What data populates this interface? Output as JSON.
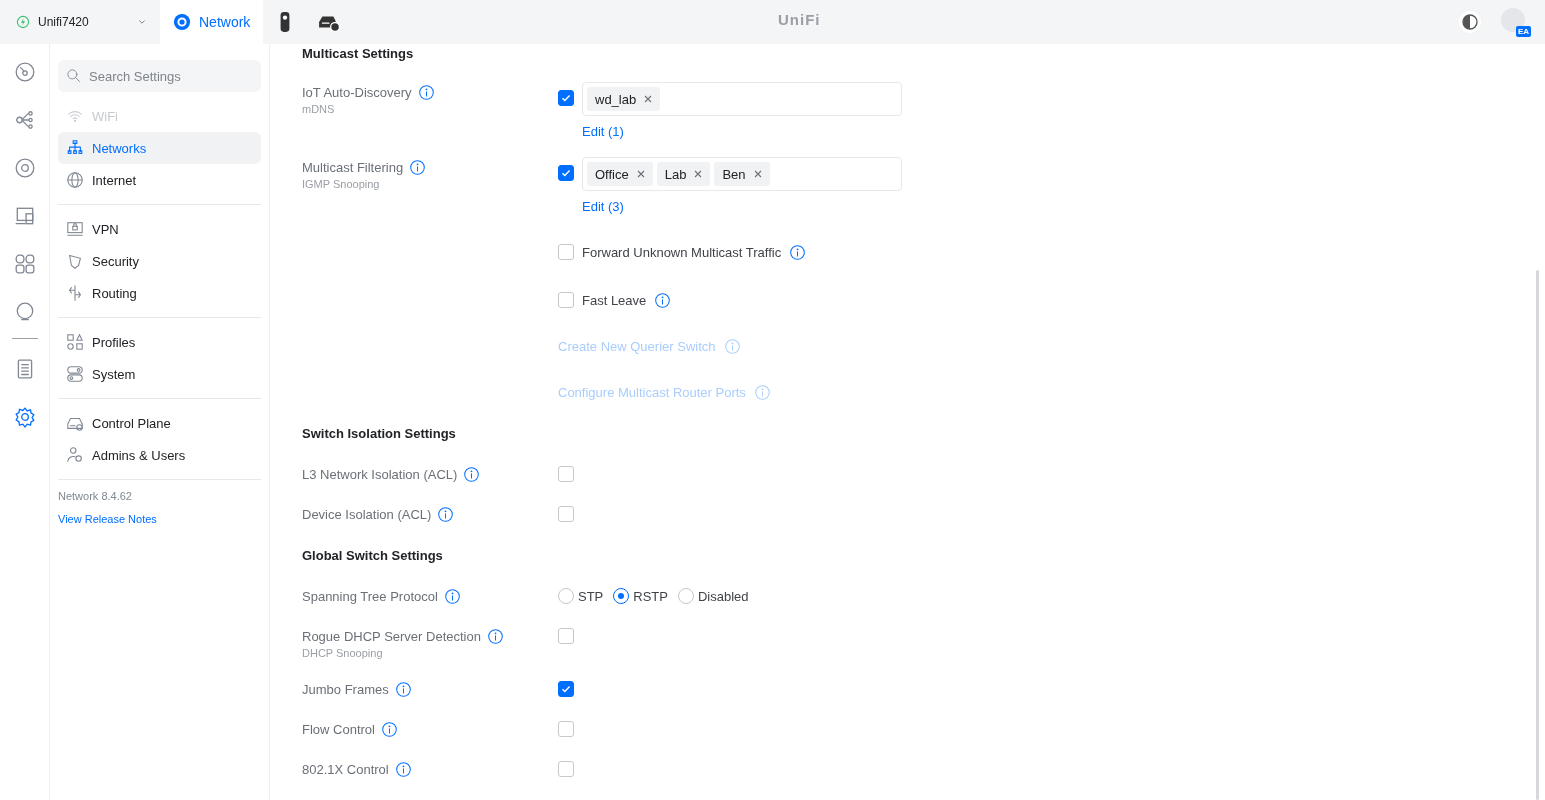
{
  "topbar": {
    "site": "Unifi7420",
    "logo": "UniFi",
    "avatar_badge": "EA"
  },
  "app_tabs": [
    {
      "kind": "labeled",
      "label": "Network",
      "selected": true
    },
    {
      "kind": "icon",
      "selected": false
    },
    {
      "kind": "icon",
      "selected": false
    }
  ],
  "rail_groups": [
    [
      {
        "selected": false
      },
      {
        "selected": false
      },
      {
        "selected": false
      },
      {
        "selected": false
      },
      {
        "selected": false
      },
      {
        "selected": false
      }
    ],
    [
      {
        "selected": false
      },
      {
        "selected": true
      }
    ]
  ],
  "sidebar": {
    "search": {
      "placeholder": "Search Settings"
    },
    "groups": [
      [
        {
          "label": "WiFi",
          "selected": false,
          "disabled": true
        },
        {
          "label": "Networks",
          "selected": true,
          "disabled": false
        },
        {
          "label": "Internet",
          "selected": false,
          "disabled": false
        }
      ],
      [
        {
          "label": "VPN",
          "selected": false,
          "disabled": false
        },
        {
          "label": "Security",
          "selected": false,
          "disabled": false
        },
        {
          "label": "Routing",
          "selected": false,
          "disabled": false
        }
      ],
      [
        {
          "label": "Profiles",
          "selected": false,
          "disabled": false
        },
        {
          "label": "System",
          "selected": false,
          "disabled": false
        }
      ],
      [
        {
          "label": "Control Plane",
          "selected": false,
          "disabled": false
        },
        {
          "label": "Admins & Users",
          "selected": false,
          "disabled": false
        }
      ]
    ],
    "version": "Network 8.4.62",
    "release_notes_link": "View Release Notes"
  },
  "sections": [
    {
      "title": "Multicast Settings",
      "rows": [
        {
          "kind": "tags",
          "label": "IoT Auto-Discovery",
          "sublabel": "mDNS",
          "checked": true,
          "tags": [
            "wd_lab"
          ],
          "edit": "Edit (1)"
        },
        {
          "kind": "tags",
          "label": "Multicast Filtering",
          "sublabel": "IGMP Snooping",
          "checked": true,
          "tags": [
            "Office",
            "Lab",
            "Ben"
          ],
          "edit": "Edit (3)"
        },
        {
          "kind": "option",
          "text": "Forward Unknown Multicast Traffic",
          "checked": false
        },
        {
          "kind": "option",
          "text": "Fast Leave",
          "checked": false
        },
        {
          "kind": "link",
          "text": "Create New Querier Switch",
          "disabled": true
        },
        {
          "kind": "link",
          "text": "Configure Multicast Router Ports",
          "disabled": true
        }
      ]
    },
    {
      "title": "Switch Isolation Settings",
      "rows": [
        {
          "kind": "checkbox",
          "label": "L3 Network Isolation (ACL)",
          "checked": false
        },
        {
          "kind": "checkbox",
          "label": "Device Isolation (ACL)",
          "checked": false
        }
      ]
    },
    {
      "title": "Global Switch Settings",
      "rows": [
        {
          "kind": "radio",
          "label": "Spanning Tree Protocol",
          "options": [
            {
              "label": "STP",
              "selected": false
            },
            {
              "label": "RSTP",
              "selected": true
            },
            {
              "label": "Disabled",
              "selected": false
            }
          ]
        },
        {
          "kind": "checkbox",
          "label": "Rogue DHCP Server Detection",
          "sublabel": "DHCP Snooping",
          "checked": false
        },
        {
          "kind": "checkbox",
          "label": "Jumbo Frames",
          "checked": true
        },
        {
          "kind": "checkbox",
          "label": "Flow Control",
          "checked": false
        },
        {
          "kind": "checkbox",
          "label": "802.1X Control",
          "checked": false
        }
      ]
    }
  ]
}
